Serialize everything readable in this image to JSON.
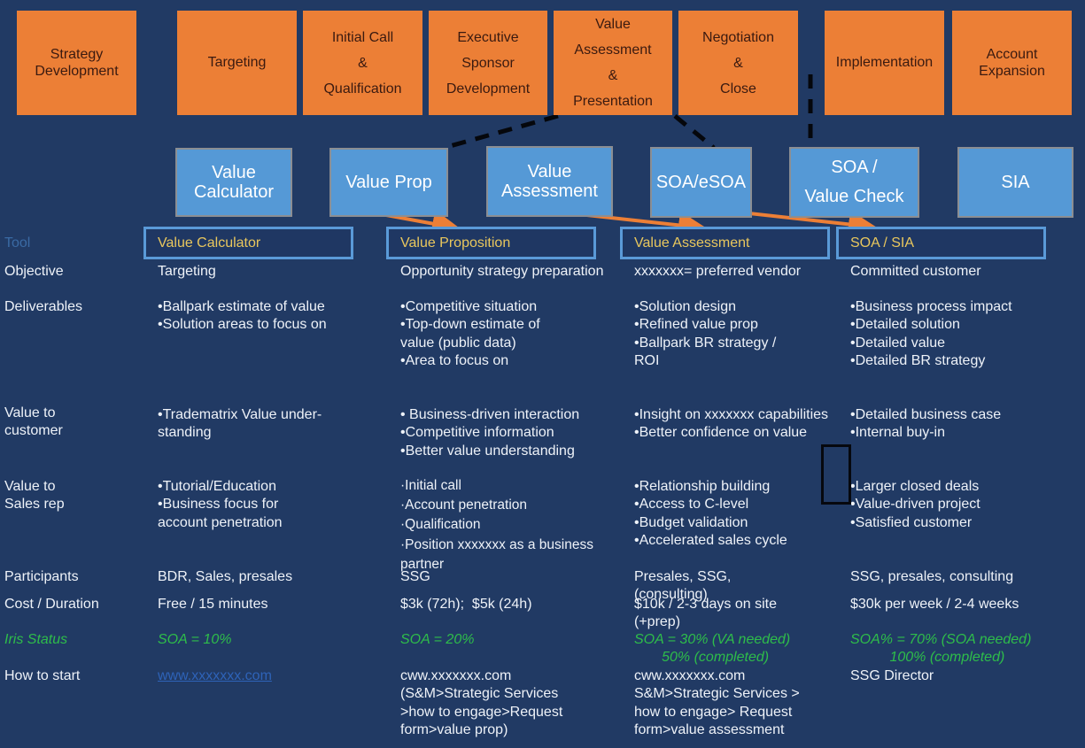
{
  "stages": [
    {
      "label": "Strategy\nDevelopment"
    },
    {
      "label": "Targeting"
    },
    {
      "label": "Initial Call\n&\nQualification"
    },
    {
      "label": "Executive\nSponsor\nDevelopment"
    },
    {
      "label": "Value\nAssessment\n&\nPresentation"
    },
    {
      "label": "Negotiation\n&\nClose"
    },
    {
      "label": "Implementation"
    },
    {
      "label": "Account\nExpansion"
    }
  ],
  "tools": [
    {
      "label": "Value\nCalculator"
    },
    {
      "label": "Value Prop"
    },
    {
      "label": "Value\nAssessment"
    },
    {
      "label": "SOA/eSOA"
    },
    {
      "label": "SOA /\nValue Check"
    },
    {
      "label": "SIA"
    }
  ],
  "table": {
    "tool_row_label": "Tool",
    "tool_headers": [
      "Value Calculator",
      "Value Proposition",
      "Value Assessment",
      "SOA / SIA"
    ],
    "rows": {
      "objective": {
        "label": "Objective",
        "cells": [
          [
            "Targeting"
          ],
          [
            "Opportunity strategy preparation"
          ],
          [
            "xxxxxxx= preferred vendor"
          ],
          [
            "Committed customer"
          ]
        ]
      },
      "deliverables": {
        "label": "Deliverables",
        "cells": [
          [
            "•Ballpark estimate of value",
            "•Solution areas to focus on"
          ],
          [
            "•Competitive situation",
            "•Top-down estimate of",
            "value (public data)",
            "•Area to focus on"
          ],
          [
            "•Solution design",
            "•Refined value prop",
            "•Ballpark BR strategy /",
            "ROI"
          ],
          [
            "•Business process impact",
            "•Detailed solution",
            "•Detailed value",
            "•Detailed BR strategy"
          ]
        ]
      },
      "value_to_customer": {
        "label": "Value to\n customer",
        "cells": [
          [
            "•Tradematrix Value under-",
            "standing"
          ],
          [
            "• Business-driven interaction",
            "•Competitive information",
            "•Better value understanding"
          ],
          [
            "•Insight on xxxxxxx capabilities",
            "•Better confidence on value"
          ],
          [
            "•Detailed business case",
            "•Internal buy-in"
          ]
        ]
      },
      "value_to_sales_rep": {
        "label": "Value to\nSales rep",
        "cells": [
          [
            "•Tutorial/Education",
            "•Business focus for",
            "account penetration"
          ],
          [
            "·Initial call",
            "·Account penetration",
            "·Qualification",
            "·Position xxxxxxx as a business",
            "partner"
          ],
          [
            "•Relationship building",
            "•Access to C-level",
            "•Budget validation",
            "•Accelerated sales cycle"
          ],
          [
            "•Larger closed deals",
            "•Value-driven project",
            "•Satisfied customer"
          ]
        ]
      },
      "participants": {
        "label": "Participants",
        "cells": [
          [
            "BDR, Sales, presales"
          ],
          [
            "SSG"
          ],
          [
            "Presales, SSG,",
            "(consulting)"
          ],
          [
            "SSG, presales, consulting"
          ]
        ]
      },
      "cost_duration": {
        "label": "Cost / Duration",
        "cells": [
          [
            "Free / 15 minutes"
          ],
          [
            "$3k (72h);  $5k (24h)"
          ],
          [
            "$10k / 2-3 days on site",
            "(+prep)"
          ],
          [
            "$30k per week / 2-4 weeks"
          ]
        ]
      },
      "iris_status": {
        "label": "Iris Status",
        "cells": [
          [
            "SOA = 10%"
          ],
          [
            "SOA = 20%"
          ],
          [
            "SOA = 30% (VA needed)",
            "       50% (completed)"
          ],
          [
            "SOA% = 70% (SOA needed)",
            "          100% (completed)"
          ]
        ]
      },
      "how_to_start": {
        "label": "How to start",
        "cells": [
          [
            "www.xxxxxxx.com"
          ],
          [
            "cww.xxxxxxx.com",
            "(S&M>Strategic Services",
            ">how to engage>Request",
            "form>value prop)"
          ],
          [
            "cww.xxxxxxx.com",
            "S&M>Strategic Services >",
            "how to engage> Request",
            "form>value assessment"
          ],
          [
            "SSG Director"
          ]
        ]
      }
    }
  },
  "colors": {
    "background": "#213a64",
    "stage_fill": "#ec7f36",
    "tool_fill": "#5599d6",
    "header_text": "#e9c75d",
    "header_border": "#5a9ad8",
    "iris_green": "#2ebd4a",
    "link_blue": "#2e63b8",
    "arrow_orange": "#ec7f36"
  }
}
